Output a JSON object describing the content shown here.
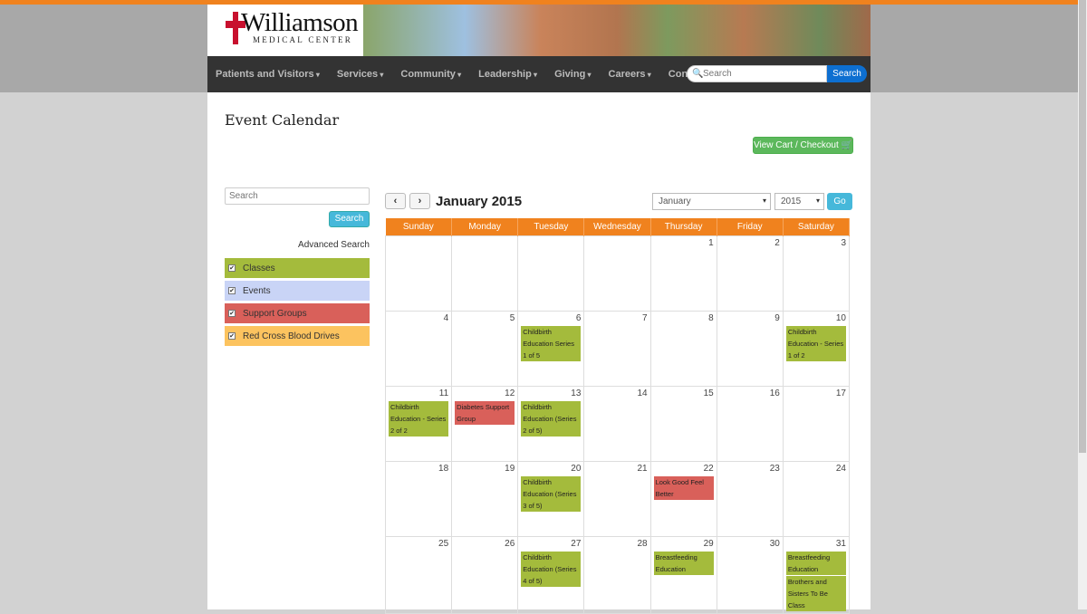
{
  "brand": {
    "name": "Williamson",
    "sub": "MEDICAL CENTER",
    "color": "#c8102e"
  },
  "nav": {
    "items": [
      "Patients and Visitors",
      "Services",
      "Community",
      "Leadership",
      "Giving",
      "Careers",
      "Contact"
    ],
    "search_placeholder": "Search",
    "search_button": "Search"
  },
  "page": {
    "title": "Event Calendar",
    "cart_button": "View Cart / Checkout 🛒"
  },
  "sidebar": {
    "search_placeholder": "Search",
    "search_button": "Search",
    "advanced": "Advanced Search",
    "filters": [
      {
        "label": "Classes",
        "color": "#a4bb3c"
      },
      {
        "label": "Events",
        "color": "#c9d4f6"
      },
      {
        "label": "Support Groups",
        "color": "#d9605a"
      },
      {
        "label": "Red Cross Blood Drives",
        "color": "#fcc35f"
      }
    ]
  },
  "calendar": {
    "month_label": "January 2015",
    "month_select": "January",
    "year_select": "2015",
    "go": "Go",
    "days": [
      "Sunday",
      "Monday",
      "Tuesday",
      "Wednesday",
      "Thursday",
      "Friday",
      "Saturday"
    ],
    "weeks": [
      [
        {
          "d": ""
        },
        {
          "d": ""
        },
        {
          "d": ""
        },
        {
          "d": ""
        },
        {
          "d": "1"
        },
        {
          "d": "2"
        },
        {
          "d": "3"
        }
      ],
      [
        {
          "d": "4"
        },
        {
          "d": "5"
        },
        {
          "d": "6",
          "ev": [
            {
              "t": "Childbirth Education Series 1 of 5",
              "k": "c"
            }
          ]
        },
        {
          "d": "7"
        },
        {
          "d": "8"
        },
        {
          "d": "9"
        },
        {
          "d": "10",
          "ev": [
            {
              "t": "Childbirth Education - Series 1 of 2",
              "k": "c"
            }
          ]
        }
      ],
      [
        {
          "d": "11",
          "ev": [
            {
              "t": "Childbirth Education - Series 2 of 2",
              "k": "c"
            }
          ]
        },
        {
          "d": "12",
          "ev": [
            {
              "t": "Diabetes Support Group",
              "k": "s"
            }
          ]
        },
        {
          "d": "13",
          "ev": [
            {
              "t": "Childbirth Education (Series 2 of 5)",
              "k": "c"
            }
          ]
        },
        {
          "d": "14"
        },
        {
          "d": "15"
        },
        {
          "d": "16"
        },
        {
          "d": "17"
        }
      ],
      [
        {
          "d": "18"
        },
        {
          "d": "19"
        },
        {
          "d": "20",
          "ev": [
            {
              "t": "Childbirth Education (Series 3 of 5)",
              "k": "c"
            }
          ]
        },
        {
          "d": "21"
        },
        {
          "d": "22",
          "ev": [
            {
              "t": "Look Good Feel Better",
              "k": "s"
            }
          ]
        },
        {
          "d": "23"
        },
        {
          "d": "24"
        }
      ],
      [
        {
          "d": "25"
        },
        {
          "d": "26"
        },
        {
          "d": "27",
          "ev": [
            {
              "t": "Childbirth Education (Series 4 of 5)",
              "k": "c"
            }
          ]
        },
        {
          "d": "28"
        },
        {
          "d": "29",
          "ev": [
            {
              "t": "Breastfeeding Education",
              "k": "c"
            }
          ]
        },
        {
          "d": "30"
        },
        {
          "d": "31",
          "ev": [
            {
              "t": "Breastfeeding Education",
              "k": "c"
            },
            {
              "t": "Brothers and Sisters To Be Class",
              "k": "c"
            }
          ]
        }
      ]
    ]
  }
}
